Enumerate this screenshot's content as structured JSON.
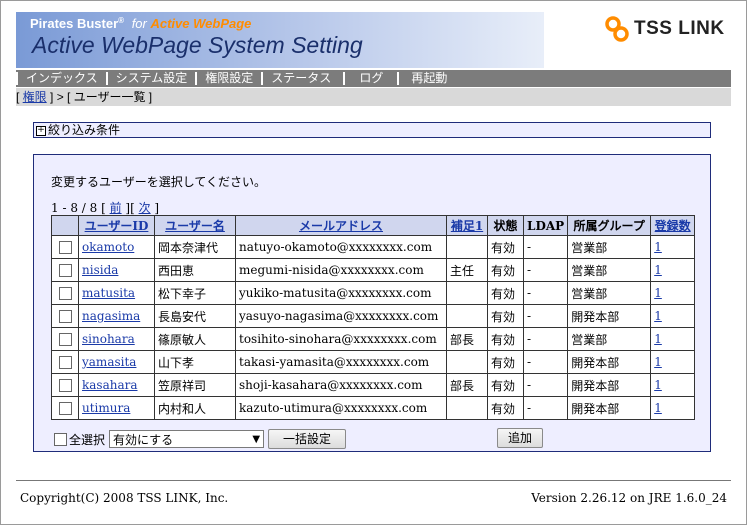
{
  "header": {
    "brand": "Pirates Buster",
    "brand_reg": "®",
    "brand_for": "for",
    "brand_product": "Active WebPage",
    "title": "Active WebPage System Setting",
    "logo_text": "TSS LINK"
  },
  "menu": {
    "items": [
      {
        "label": "インデックス"
      },
      {
        "label": "システム設定"
      },
      {
        "label": "権限設定"
      },
      {
        "label": "ステータス"
      },
      {
        "label": "ログ"
      },
      {
        "label": "再起動"
      }
    ]
  },
  "breadcrumb": {
    "open": "[ ",
    "link": "権限",
    "mid": " ] > [ ",
    "current": "ユーザー一覧",
    "close": " ]"
  },
  "filter": {
    "toggle": "+",
    "label": "絞り込み条件"
  },
  "panel": {
    "instruction": "変更するユーザーを選択してください。",
    "pager": {
      "range": "1 - 8 / 8 [ ",
      "prev": "前",
      "sep": " ][ ",
      "next": "次",
      "close": " ]"
    },
    "columns": {
      "userid": "ユーザーID",
      "username": "ユーザー名",
      "email": "メールアドレス",
      "note": "補足1",
      "status": "状態",
      "ldap": "LDAP",
      "group": "所属グループ",
      "count": "登録数"
    },
    "rows": [
      {
        "userid": "okamoto",
        "name": "岡本奈津代",
        "email": "natuyo-okamoto@xxxxxxxx.com",
        "note": "",
        "status": "有効",
        "ldap": "-",
        "group": "営業部",
        "count": "1"
      },
      {
        "userid": "nisida",
        "name": "西田恵",
        "email": "megumi-nisida@xxxxxxxx.com",
        "note": "主任",
        "status": "有効",
        "ldap": "-",
        "group": "営業部",
        "count": "1"
      },
      {
        "userid": "matusita",
        "name": "松下幸子",
        "email": "yukiko-matusita@xxxxxxxx.com",
        "note": "",
        "status": "有効",
        "ldap": "-",
        "group": "営業部",
        "count": "1"
      },
      {
        "userid": "nagasima",
        "name": "長島安代",
        "email": "yasuyo-nagasima@xxxxxxxx.com",
        "note": "",
        "status": "有効",
        "ldap": "-",
        "group": "開発本部",
        "count": "1"
      },
      {
        "userid": "sinohara",
        "name": "篠原敏人",
        "email": "tosihito-sinohara@xxxxxxxx.com",
        "note": "部長",
        "status": "有効",
        "ldap": "-",
        "group": "営業部",
        "count": "1"
      },
      {
        "userid": "yamasita",
        "name": "山下孝",
        "email": "takasi-yamasita@xxxxxxxx.com",
        "note": "",
        "status": "有効",
        "ldap": "-",
        "group": "開発本部",
        "count": "1"
      },
      {
        "userid": "kasahara",
        "name": "笠原祥司",
        "email": "shoji-kasahara@xxxxxxxx.com",
        "note": "部長",
        "status": "有効",
        "ldap": "-",
        "group": "開発本部",
        "count": "1"
      },
      {
        "userid": "utimura",
        "name": "内村和人",
        "email": "kazuto-utimura@xxxxxxxx.com",
        "note": "",
        "status": "有効",
        "ldap": "-",
        "group": "開発本部",
        "count": "1"
      }
    ],
    "select_all_label": "全選択",
    "action_select": {
      "value": "有効にする"
    },
    "bulk_button": "一括設定",
    "add_button": "追加"
  },
  "footer": {
    "copyright": "Copyright(C) 2008 TSS LINK, Inc.",
    "version": "Version 2.26.12 on JRE 1.6.0_24"
  },
  "colors": {
    "accent_orange": "#ff8c00",
    "title_blue": "#1a2f6b",
    "link_blue": "#1a3aa8",
    "panel_bg": "#eeeeff",
    "menu_bg": "#7c7c7c"
  }
}
